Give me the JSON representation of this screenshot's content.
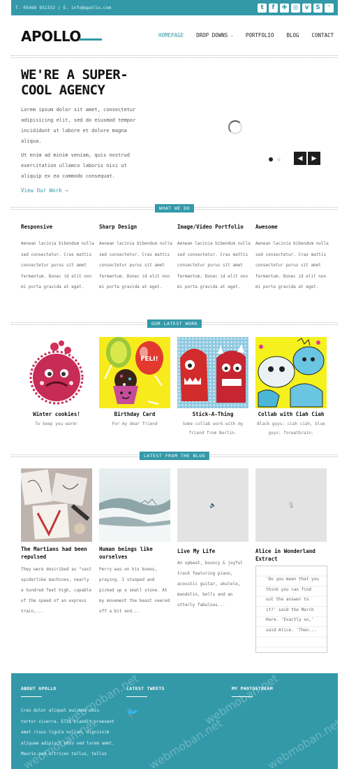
{
  "topbar": {
    "contact": "T. 05468 951332 | E. info@apollo.com",
    "social_icons": [
      "twitter-icon",
      "facebook-icon",
      "plus-icon",
      "dribbble-icon",
      "vimeo-icon",
      "skype-icon",
      "rss-icon"
    ]
  },
  "header": {
    "logo": "APOLLO",
    "nav": [
      "HOMEPAGE",
      "DROP DOWNS",
      "PORTFOLIO",
      "BLOG",
      "CONTACT"
    ],
    "dropdown_caret": "▾"
  },
  "hero": {
    "title": "WE'RE A SUPER-COOL AGENCY",
    "p1": "Lorem ipsum dolor sit amet, consectetur adipisicing elit, sed do eiusmod tempor incididunt ut labore et dolore magna aliqua.",
    "p2": "Ut enim ad minim veniam, quis nostrud exercitation ullamco laboris nisi ut aliquip ex ea commodo consequat.",
    "link": "View Our Work →",
    "prev": "◀",
    "next": "▶"
  },
  "what_we_do": {
    "label": "WHAT WE DO",
    "columns": [
      {
        "title": "Responsive",
        "text": "Aenean lacinia bibendum nulla sed consectetur. Cras mattis consectetur purus sit amet fermentum. Donec id elit non mi porta gravida at eget."
      },
      {
        "title": "Sharp Design",
        "text": "Aenean lacinia bibendum nulla sed consectetur. Cras mattis consectetur purus sit amet fermentum. Donec id elit non mi porta gravida at eget."
      },
      {
        "title": "Image/Video Portfolio",
        "text": "Aenean lacinia bibendum nulla sed consectetur. Cras mattis consectetur purus sit amet fermentum. Donec id elit non mi porta gravida at eget."
      },
      {
        "title": "Awesome",
        "text": "Aenean lacinia bibendum nulla sed consectetur. Cras mattis consectetur purus sit amet fermentum. Donec id elit non mi porta gravida at eget."
      }
    ]
  },
  "latest_work": {
    "label": "OUR LATEST WORK",
    "items": [
      {
        "title": "Winter cookies!",
        "sub": "To keep you warm!"
      },
      {
        "title": "Birthday Card",
        "sub": "For my dear friend"
      },
      {
        "title": "Stick-A-Thing",
        "sub": "Some collab work with my friend from Berlin."
      },
      {
        "title": "Collab with Ciah Ciah",
        "sub": "Black guys: ciah ciah, blue guys: forwatbrain."
      }
    ],
    "balloon_text": "FELI!"
  },
  "blog": {
    "label": "LATEST FROM THE BLOG",
    "posts": [
      {
        "title": "The Martians had been repulsed",
        "text": "They were described as \"vast spiderlike machines, nearly a hundred feet high, capable of the speed of an express train,..."
      },
      {
        "title": "Human beings like ourselves",
        "text": "Perry was on his knees, praying. I stooped and picked up a small stone. At my movement the beast veered off a bit and..."
      },
      {
        "title": "Live My Life",
        "text": "An upbeat, bouncy & joyful track featuring piano, acoustic guitar, ukulele, mandolin, bells and an utterly fabulous..."
      },
      {
        "title": "Alice in Wonderland Extract",
        "quote": "'Do you mean that you think you can find out the answer to it?' said the March Hare. 'Exactly so,' said Alice. 'Then..."
      }
    ]
  },
  "footer": {
    "about_head": "ABOUT APOLLO",
    "tweets_head": "LATEST TWEETS",
    "photo_head": "MY PHOTOSTREAM",
    "about_text": "Cras dolor aliquet euismod odio tortor viverra. Elit blandit praesent amet risus ligula nullam, dignissim aliquam adipisci odio sed lorem amet. Mauris sed ultrices tellus, tellus",
    "watermark": "webmoban.net"
  },
  "colors": {
    "accent": "#3399a9"
  }
}
